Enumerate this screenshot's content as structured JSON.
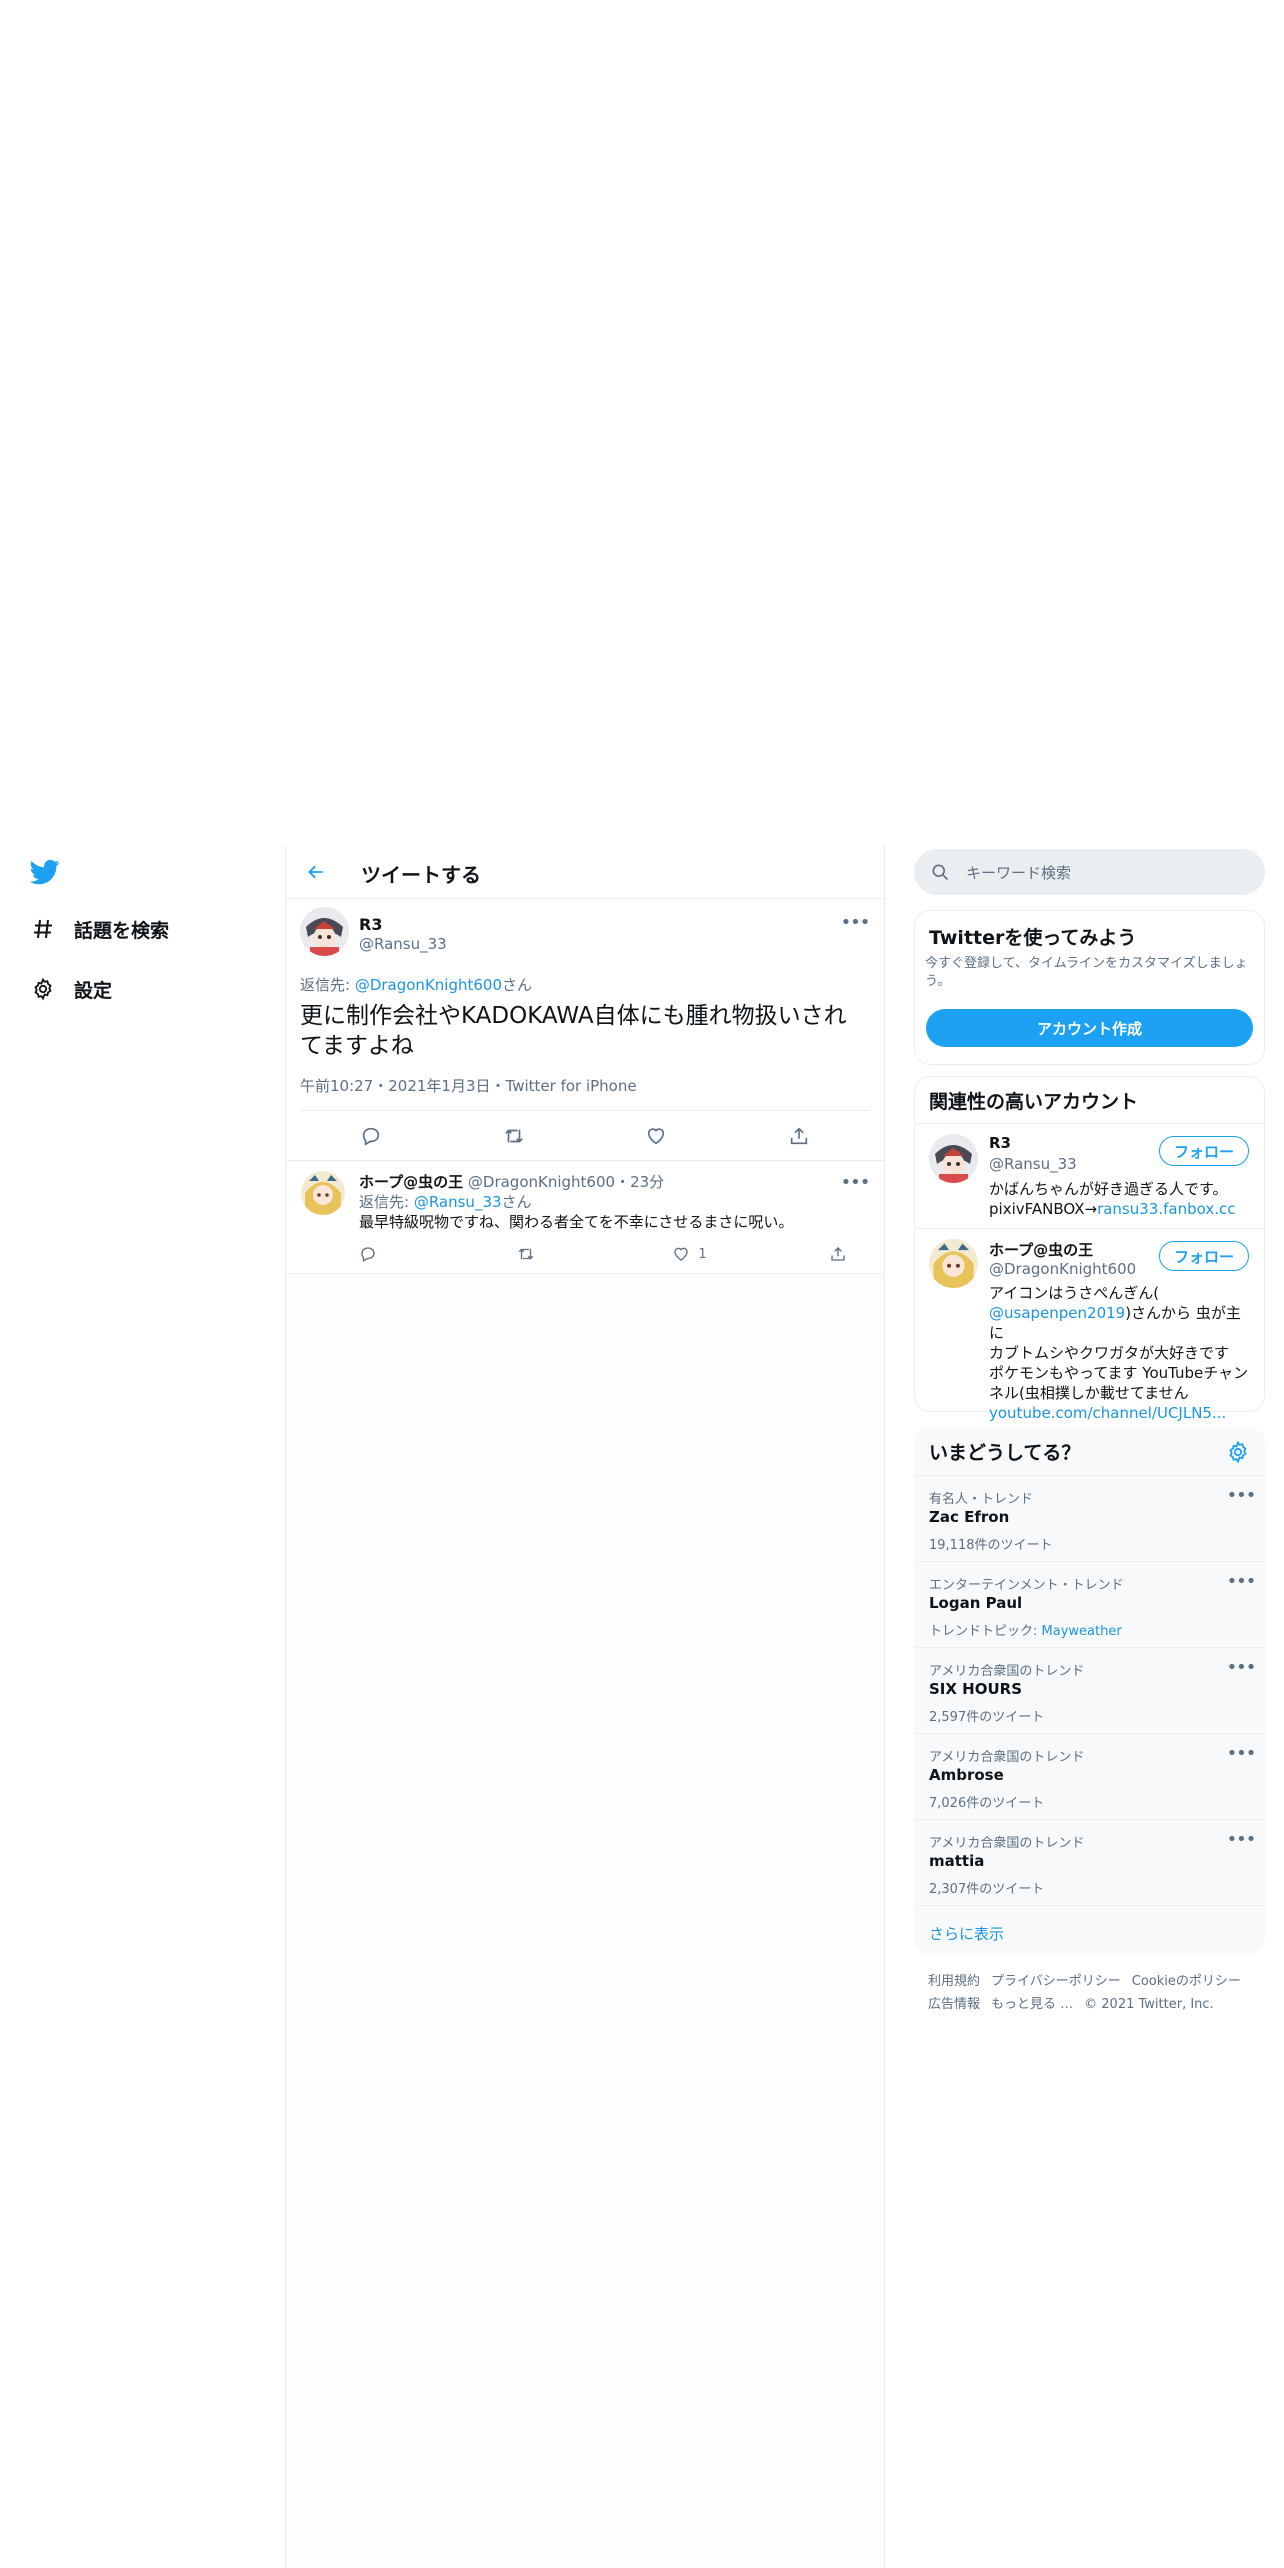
{
  "nav": {
    "items": [
      {
        "label": "話題を検索",
        "icon": "hashtag-icon"
      },
      {
        "label": "設定",
        "icon": "gear-icon"
      }
    ]
  },
  "header": {
    "title": "ツイートする"
  },
  "main_tweet": {
    "name": "R3",
    "handle": "@Ransu_33",
    "reply_prefix": "返信先: ",
    "reply_to": "@DragonKnight600",
    "reply_suffix": "さん",
    "text": "更に制作会社やKADOKAWA自体にも腫れ物扱いされてますよね",
    "time": "午前10:27",
    "date": "2021年1月3日",
    "source": "Twitter for iPhone",
    "sep": "・"
  },
  "reply_tweet": {
    "name": "ホープ@虫の王",
    "handle": "@DragonKnight600",
    "time": "23分",
    "sep": "・",
    "reply_prefix": "返信先: ",
    "reply_to": "@Ransu_33",
    "reply_suffix": "さん",
    "text": "最早特級呪物ですね、関わる者全てを不幸にさせるまさに呪い。",
    "like_count": "1"
  },
  "search": {
    "placeholder": "キーワード検索"
  },
  "signup": {
    "title": "Twitterを使ってみよう",
    "desc": "今すぐ登録して、タイムラインをカスタマイズしましょう。",
    "button": "アカウント作成"
  },
  "related": {
    "title": "関連性の高いアカウント",
    "follow_label": "フォロー",
    "accounts": [
      {
        "name": "R3",
        "handle": "@Ransu_33",
        "bio_line1": "かばんちゃんが好き過ぎる人です。",
        "bio_line2_text": "pixivFANBOX→",
        "bio_line2_link": "ransu33.fanbox.cc"
      },
      {
        "name": "ホープ@虫の王",
        "handle": "@DragonKnight600",
        "bio_line1": "アイコンはうさぺんぎん(",
        "bio_link": "@usapenpen2019",
        "bio_after_link": ")さんから 虫が主に",
        "bio_line3": "カブトムシやクワガタが大好きです",
        "bio_line4": "ポケモンもやってます YouTubeチャン",
        "bio_line5": "ネル(虫相撲しか載せてません",
        "bio_url": "youtube.com/channel/UCJLN5..."
      }
    ]
  },
  "trends": {
    "title": "いまどうしてる？",
    "items": [
      {
        "context": "有名人・トレンド",
        "name": "Zac Efron",
        "count": "19,118件のツイート"
      },
      {
        "context": "エンターテインメント・トレンド",
        "name": "Logan Paul",
        "count_prefix": "トレンドトピック: ",
        "count_link": "Mayweather"
      },
      {
        "context": "アメリカ合衆国のトレンド",
        "name": "SIX HOURS",
        "count": "2,597件のツイート"
      },
      {
        "context": "アメリカ合衆国のトレンド",
        "name": "Ambrose",
        "count": "7,026件のツイート"
      },
      {
        "context": "アメリカ合衆国のトレンド",
        "name": "mattia",
        "count": "2,307件のツイート"
      }
    ],
    "show_more": "さらに表示"
  },
  "footer": {
    "links": [
      "利用規約",
      "プライバシーポリシー",
      "Cookieのポリシー",
      "広告情報",
      "もっと見る …"
    ],
    "copyright": "© 2021 Twitter, Inc."
  },
  "colors": {
    "accent": "#1da1f2",
    "link": "#1b95e0",
    "text": "#0f1419",
    "secondary": "#5b7083",
    "border": "#ebeef0"
  }
}
